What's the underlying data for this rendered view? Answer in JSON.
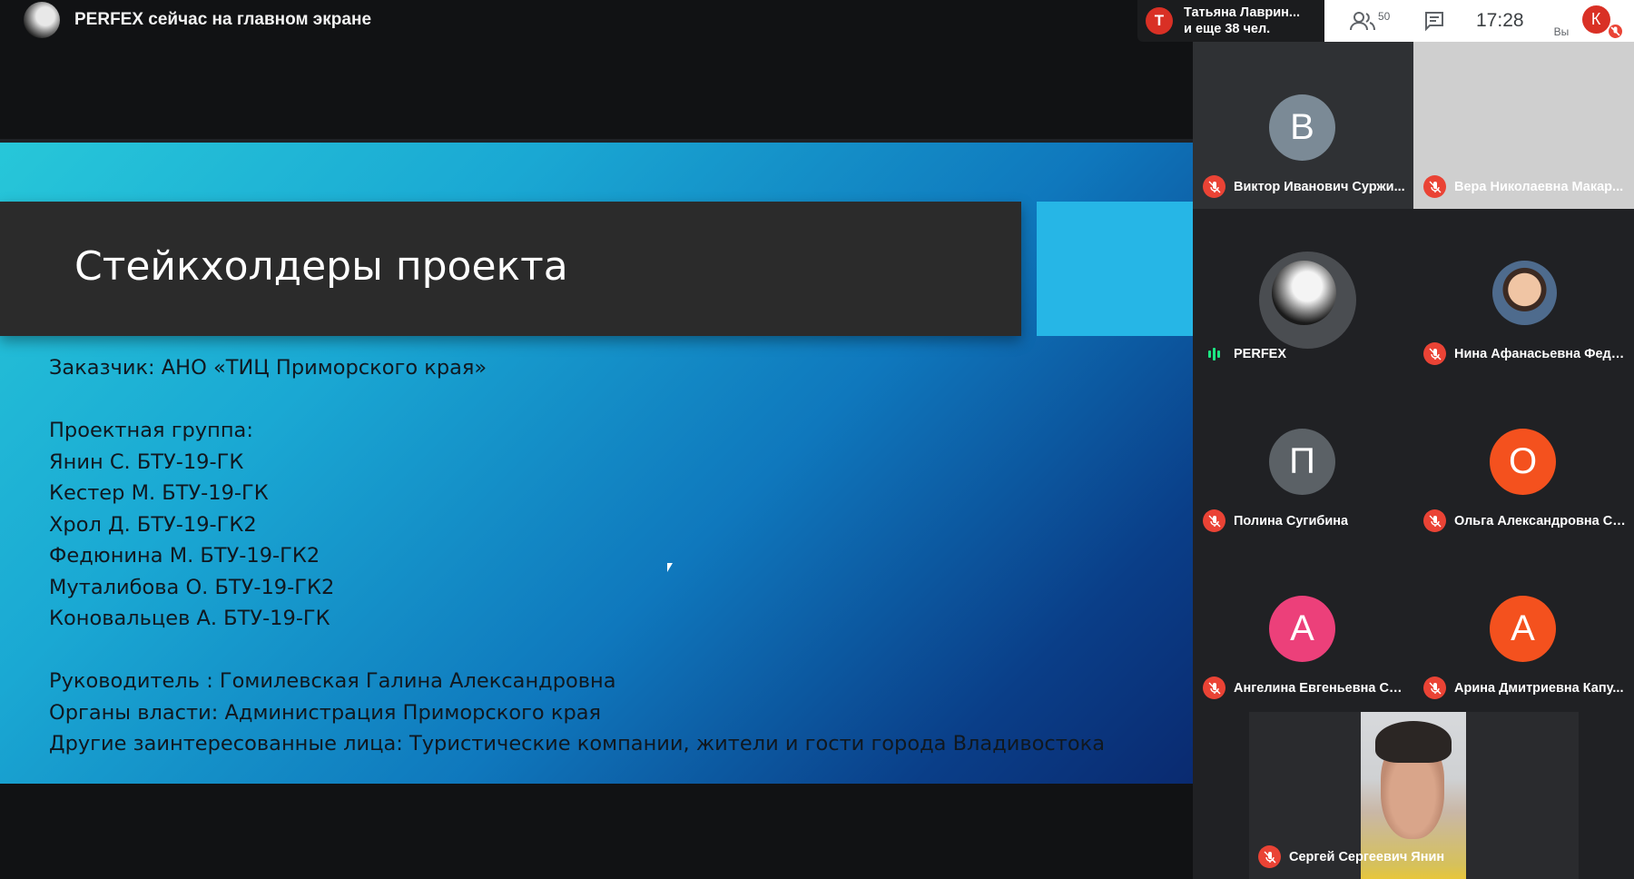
{
  "presenter": {
    "text": "PERFEX сейчас на главном экране"
  },
  "speaker": {
    "initial": "Т",
    "line1": "Татьяна Лаврин...",
    "line2": "и еще 38 чел."
  },
  "controls": {
    "people_count": "50",
    "time": "17:28",
    "you_label": "Вы",
    "self_initial": "К"
  },
  "slide": {
    "title": "Стейкхолдеры проекта",
    "lines": [
      "Заказчик: АНО «ТИЦ Приморского края»",
      "",
      "Проектная группа:",
      "Янин С. БТУ-19-ГК",
      "Кестер М. БТУ-19-ГК",
      "Хрол Д. БТУ-19-ГК2",
      "Федюнина М. БТУ-19-ГК2",
      "Муталибова О. БТУ-19-ГК2",
      "Коновальцев А. БТУ-19-ГК",
      "",
      "Руководитель : Гомилевская Галина Александровна",
      "Органы власти: Администрация Приморского края",
      "Другие заинтересованные лица: Туристические компании, жители и гости города Владивостока"
    ]
  },
  "participants": [
    {
      "name": "Виктор Иванович Суржи...",
      "initial": "В",
      "color": "#7b8a96"
    },
    {
      "name": "Вера Николаевна Макар...",
      "initial": "",
      "color": "#d2d2d2"
    },
    {
      "name": "PERFEX",
      "initial": "",
      "color": "#3c4043"
    },
    {
      "name": "Нина Афанасьевна Федя...",
      "initial": "",
      "color": "#3c4043"
    },
    {
      "name": "Полина Сугибина",
      "initial": "П",
      "color": "#5b6166"
    },
    {
      "name": "Ольга Александровна Ст...",
      "initial": "О",
      "color": "#f4511e"
    },
    {
      "name": "Ангелина Евгеньевна Сл...",
      "initial": "А",
      "color": "#ec407a"
    },
    {
      "name": "Арина Дмитриевна Капу...",
      "initial": "А",
      "color": "#f4511e"
    }
  ],
  "self_view": {
    "name": "Сергей Сергеевич Янин"
  },
  "icons": [
    "people-icon",
    "chat-icon",
    "mic-off-icon",
    "speaking-bars-icon"
  ]
}
